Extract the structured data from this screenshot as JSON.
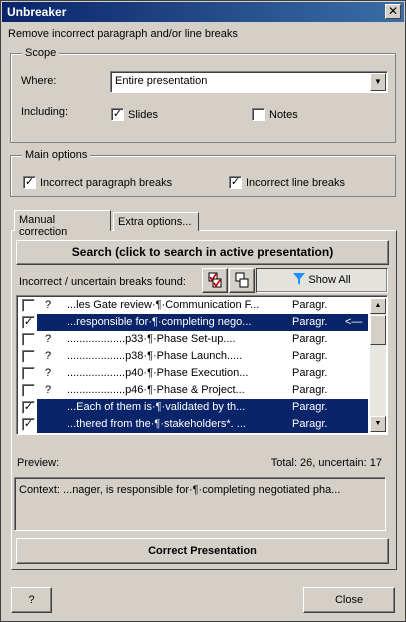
{
  "window": {
    "title": "Unbreaker",
    "close_glyph": "✕"
  },
  "description": "Remove incorrect paragraph and/or line breaks",
  "scope": {
    "legend": "Scope",
    "where_label": "Where:",
    "where_value": "Entire presentation",
    "including_label": "Including:",
    "slides_label": "Slides",
    "slides_checked": true,
    "notes_label": "Notes",
    "notes_checked": false
  },
  "main_options": {
    "legend": "Main options",
    "para_label": "Incorrect paragraph breaks",
    "para_checked": true,
    "line_label": "Incorrect line breaks",
    "line_checked": true
  },
  "tabs": [
    {
      "label": "Manual correction",
      "active": true
    },
    {
      "label": "Extra options...",
      "active": false
    }
  ],
  "search_button": "Search (click to search in active presentation)",
  "found_label": "Incorrect / uncertain breaks found:",
  "show_all_label": "Show All",
  "results": [
    {
      "checked": false,
      "flag": "?",
      "context": "...les Gate review·¶·Communication F...",
      "type": "Paragr.",
      "selected": false,
      "arrow": ""
    },
    {
      "checked": true,
      "flag": "",
      "context": "...responsible for·¶·completing nego...",
      "type": "Paragr.",
      "selected": true,
      "arrow": "<—"
    },
    {
      "checked": false,
      "flag": "?",
      "context": "...................p33·¶·Phase Set-up....",
      "type": "Paragr.",
      "selected": false,
      "arrow": ""
    },
    {
      "checked": false,
      "flag": "?",
      "context": "...................p38·¶·Phase Launch.....",
      "type": "Paragr.",
      "selected": false,
      "arrow": ""
    },
    {
      "checked": false,
      "flag": "?",
      "context": "...................p40·¶·Phase Execution...",
      "type": "Paragr.",
      "selected": false,
      "arrow": ""
    },
    {
      "checked": false,
      "flag": "?",
      "context": "...................p46·¶·Phase & Project...",
      "type": "Paragr.",
      "selected": false,
      "arrow": ""
    },
    {
      "checked": true,
      "flag": "",
      "context": "...Each of them is·¶·validated by th...",
      "type": "Paragr.",
      "selected": true,
      "arrow": ""
    },
    {
      "checked": true,
      "flag": "",
      "context": "...thered from the·¶·stakeholders*. ...",
      "type": "Paragr.",
      "selected": true,
      "arrow": ""
    }
  ],
  "preview_label": "Preview:",
  "totals": "Total: 26, uncertain: 17",
  "preview_text": "Context: ...nager, is responsible for·¶·completing negotiated pha...",
  "correct_button": "Correct Presentation",
  "help_button": "?",
  "close_button": "Close",
  "colors": {
    "selection": "#0a246a",
    "dialog": "#d4d0c8",
    "titlebar_start": "#0a246a",
    "titlebar_end": "#3a6ea5"
  },
  "icons": [
    "close-icon",
    "check-mark-icon",
    "filter-icon",
    "dropdown-arrow-icon",
    "select-checked-icon",
    "select-none-icon",
    "scroll-up-icon",
    "scroll-down-icon"
  ]
}
